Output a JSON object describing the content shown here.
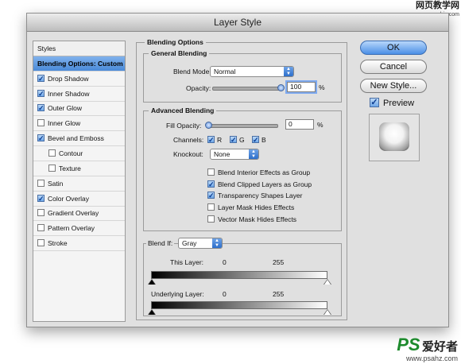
{
  "watermark": {
    "site_cn": "网页教学网",
    "site_url": "www.webjx.com"
  },
  "dialog": {
    "title": "Layer Style"
  },
  "sidebar": {
    "items": [
      {
        "label": "Styles",
        "type": "header"
      },
      {
        "label": "Blending Options: Custom",
        "type": "selected"
      },
      {
        "label": "Drop Shadow",
        "checked": true
      },
      {
        "label": "Inner Shadow",
        "checked": true
      },
      {
        "label": "Outer Glow",
        "checked": true
      },
      {
        "label": "Inner Glow",
        "checked": false
      },
      {
        "label": "Bevel and Emboss",
        "checked": true
      },
      {
        "label": "Contour",
        "checked": false,
        "indent": true
      },
      {
        "label": "Texture",
        "checked": false,
        "indent": true
      },
      {
        "label": "Satin",
        "checked": false
      },
      {
        "label": "Color Overlay",
        "checked": true
      },
      {
        "label": "Gradient Overlay",
        "checked": false
      },
      {
        "label": "Pattern Overlay",
        "checked": false
      },
      {
        "label": "Stroke",
        "checked": false
      }
    ]
  },
  "blending_options": {
    "title": "Blending Options",
    "general": {
      "title": "General Blending",
      "blend_mode_label": "Blend Mode:",
      "blend_mode_value": "Normal",
      "opacity_label": "Opacity:",
      "opacity_value": "100",
      "opacity_unit": "%",
      "opacity_level": 1.0
    },
    "advanced": {
      "title": "Advanced Blending",
      "fill_opacity_label": "Fill Opacity:",
      "fill_opacity_value": "0",
      "fill_opacity_unit": "%",
      "fill_opacity_level": 0.0,
      "channels_label": "Channels:",
      "channels": [
        {
          "label": "R",
          "checked": true
        },
        {
          "label": "G",
          "checked": true
        },
        {
          "label": "B",
          "checked": true
        }
      ],
      "knockout_label": "Knockout:",
      "knockout_value": "None",
      "options": [
        {
          "label": "Blend Interior Effects as Group",
          "checked": false
        },
        {
          "label": "Blend Clipped Layers as Group",
          "checked": true
        },
        {
          "label": "Transparency Shapes Layer",
          "checked": true
        },
        {
          "label": "Layer Mask Hides Effects",
          "checked": false
        },
        {
          "label": "Vector Mask Hides Effects",
          "checked": false
        }
      ]
    },
    "blend_if": {
      "label": "Blend If:",
      "value": "Gray",
      "this_layer_label": "This Layer:",
      "this_layer_min": "0",
      "this_layer_max": "255",
      "underlying_label": "Underlying Layer:",
      "underlying_min": "0",
      "underlying_max": "255"
    }
  },
  "buttons": {
    "ok": "OK",
    "cancel": "Cancel",
    "new_style": "New Style...",
    "preview_label": "Preview",
    "preview_checked": true
  },
  "footer_logo": {
    "ps": "PS",
    "cn": "爱好者",
    "url": "www.psahz.com"
  }
}
